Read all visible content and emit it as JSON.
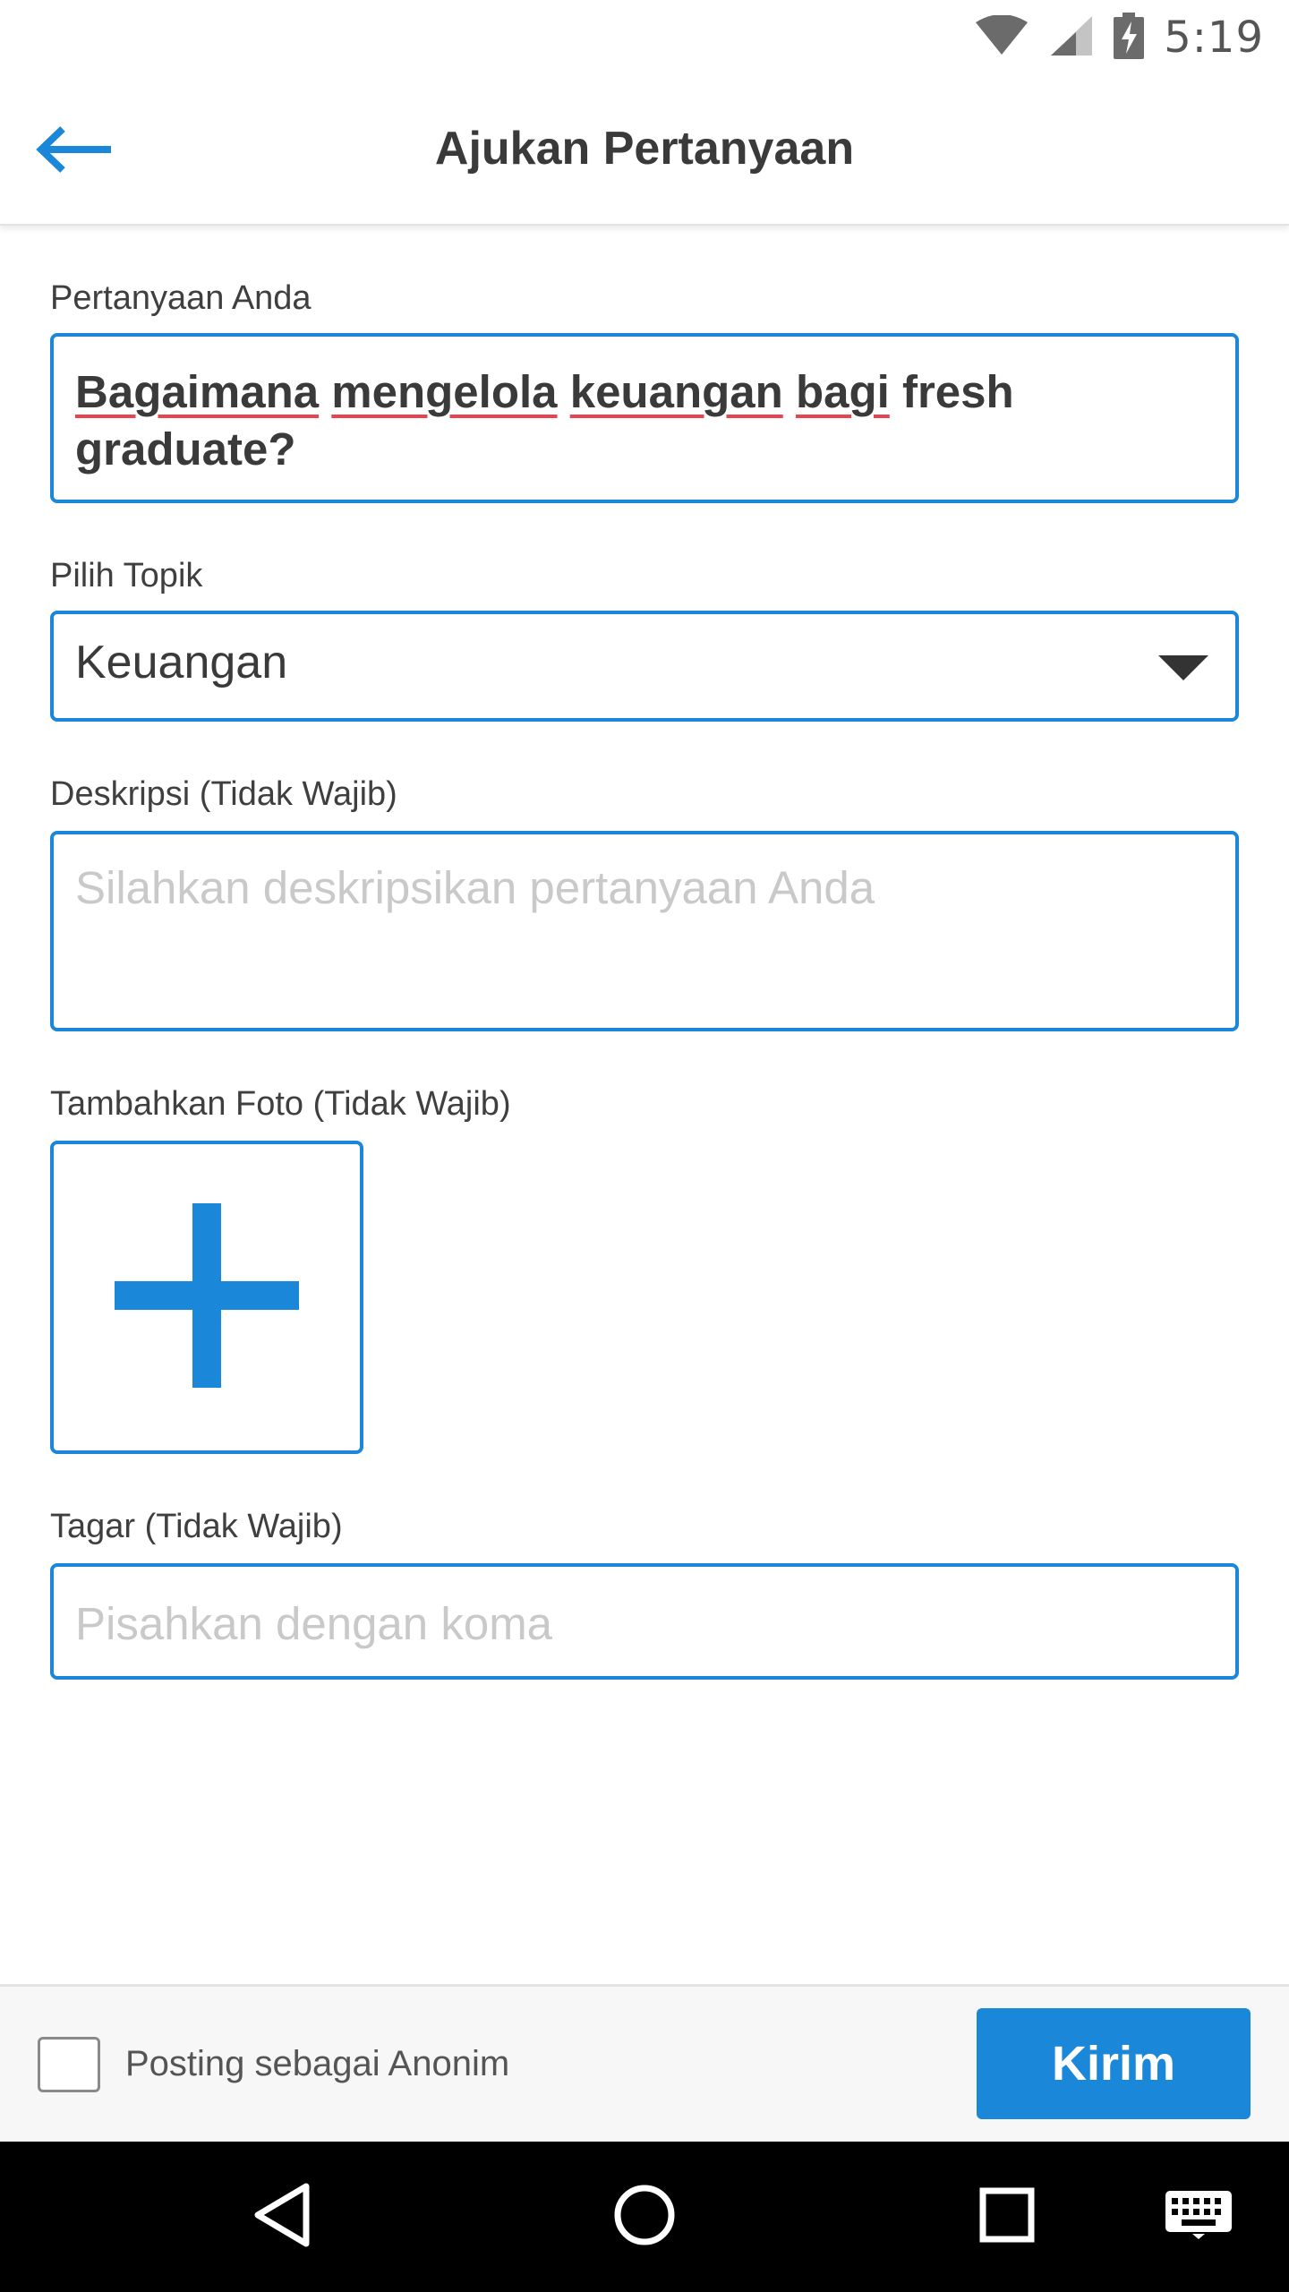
{
  "status_bar": {
    "time": "5:19",
    "icons": [
      "wifi-icon",
      "cell-signal-icon",
      "battery-charging-icon"
    ]
  },
  "app_bar": {
    "title": "Ajukan Pertanyaan",
    "back_icon": "arrow-left-icon"
  },
  "form": {
    "question": {
      "label": "Pertanyaan Anda",
      "value_words": [
        "Bagaimana",
        "mengelola",
        "keuangan",
        "bagi",
        "fresh"
      ],
      "value_line2": "graduate?"
    },
    "topic": {
      "label": "Pilih Topik",
      "selected": "Keuangan"
    },
    "description": {
      "label": "Deskripsi (Tidak Wajib)",
      "placeholder": "Silahkan deskripsikan pertanyaan Anda"
    },
    "photo": {
      "label": "Tambahkan Foto (Tidak Wajib)",
      "icon": "plus-icon"
    },
    "tags": {
      "label": "Tagar (Tidak Wajib)",
      "placeholder": "Pisahkan dengan koma"
    }
  },
  "bottom_bar": {
    "anonymous_label": "Posting sebagai Anonim",
    "anonymous_checked": false,
    "send_label": "Kirim"
  },
  "nav_bar": {
    "buttons": [
      "back-triangle-icon",
      "home-circle-icon",
      "recents-square-icon",
      "keyboard-icon"
    ]
  },
  "colors": {
    "accent": "#1b87d9",
    "spellcheck_underline": "#e8434f",
    "placeholder": "#c9c9c9",
    "nav_bar": "#000000"
  }
}
